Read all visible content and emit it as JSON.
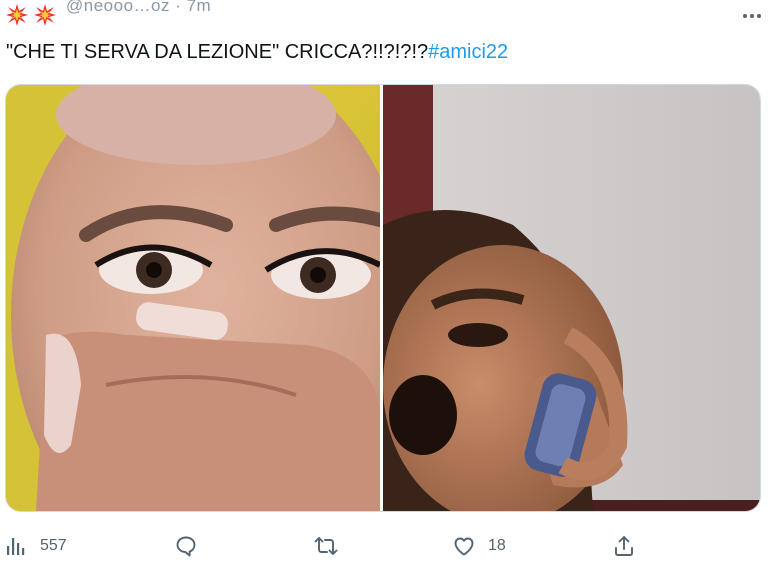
{
  "tweet": {
    "header": {
      "emojis": [
        "collision-emoji",
        "collision-emoji"
      ],
      "handle_partial": "@neooo…oz · 7m"
    },
    "text": "\"CHE TI SERVA DA LEZIONE\" CRICCA?!!?!?!?",
    "hashtag": "#amici22"
  },
  "media": {
    "images": [
      {
        "name": "photo-left",
        "description_icon": "shocked-face-photo"
      },
      {
        "name": "photo-right",
        "description_icon": "phone-call-photo"
      }
    ]
  },
  "actions": {
    "views": "557",
    "reply": "",
    "retweet": "",
    "likes": "18",
    "share": ""
  },
  "colors": {
    "accent": "#1d9bf0",
    "text": "#0f1419",
    "muted": "#536471",
    "border": "#cfd9de"
  }
}
